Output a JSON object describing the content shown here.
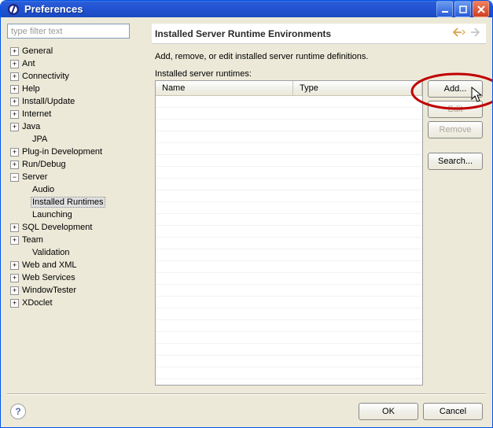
{
  "window": {
    "title": "Preferences"
  },
  "filter": {
    "placeholder": "type filter text"
  },
  "tree": {
    "items": [
      {
        "label": "General",
        "toggle": "+",
        "child": false,
        "sel": false
      },
      {
        "label": "Ant",
        "toggle": "+",
        "child": false,
        "sel": false
      },
      {
        "label": "Connectivity",
        "toggle": "+",
        "child": false,
        "sel": false
      },
      {
        "label": "Help",
        "toggle": "+",
        "child": false,
        "sel": false
      },
      {
        "label": "Install/Update",
        "toggle": "+",
        "child": false,
        "sel": false
      },
      {
        "label": "Internet",
        "toggle": "+",
        "child": false,
        "sel": false
      },
      {
        "label": "Java",
        "toggle": "+",
        "child": false,
        "sel": false
      },
      {
        "label": "JPA",
        "toggle": "",
        "child": true,
        "sel": false
      },
      {
        "label": "Plug-in Development",
        "toggle": "+",
        "child": false,
        "sel": false
      },
      {
        "label": "Run/Debug",
        "toggle": "+",
        "child": false,
        "sel": false
      },
      {
        "label": "Server",
        "toggle": "−",
        "child": false,
        "sel": false
      },
      {
        "label": "Audio",
        "toggle": "",
        "child": true,
        "sel": false
      },
      {
        "label": "Installed Runtimes",
        "toggle": "",
        "child": true,
        "sel": true
      },
      {
        "label": "Launching",
        "toggle": "",
        "child": true,
        "sel": false
      },
      {
        "label": "SQL Development",
        "toggle": "+",
        "child": false,
        "sel": false
      },
      {
        "label": "Team",
        "toggle": "+",
        "child": false,
        "sel": false
      },
      {
        "label": "Validation",
        "toggle": "",
        "child": true,
        "sel": false
      },
      {
        "label": "Web and XML",
        "toggle": "+",
        "child": false,
        "sel": false
      },
      {
        "label": "Web Services",
        "toggle": "+",
        "child": false,
        "sel": false
      },
      {
        "label": "WindowTester",
        "toggle": "+",
        "child": false,
        "sel": false
      },
      {
        "label": "XDoclet",
        "toggle": "+",
        "child": false,
        "sel": false
      }
    ]
  },
  "section": {
    "title": "Installed Server Runtime Environments",
    "description": "Add, remove, or edit installed server runtime definitions.",
    "table_label": "Installed server runtimes:"
  },
  "table": {
    "columns": [
      "Name",
      "Type"
    ],
    "rows": []
  },
  "buttons": {
    "add": "Add...",
    "edit": "Edit",
    "remove": "Remove",
    "search": "Search..."
  },
  "footer": {
    "ok": "OK",
    "cancel": "Cancel",
    "help": "?"
  }
}
